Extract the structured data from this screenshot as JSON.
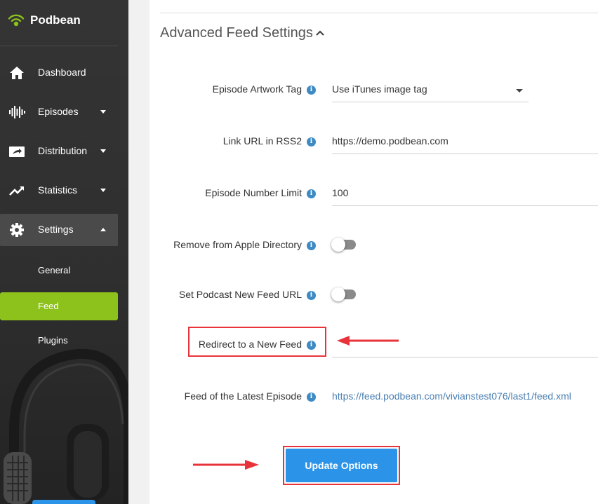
{
  "app": {
    "name": "Podbean",
    "brand_color": "#8cc21b",
    "accent_color": "#2b93e8"
  },
  "sidebar": {
    "items": [
      {
        "label": "Dashboard",
        "icon": "home-icon"
      },
      {
        "label": "Episodes",
        "icon": "waveform-icon",
        "expandable": true
      },
      {
        "label": "Distribution",
        "icon": "share-screen-icon",
        "expandable": true
      },
      {
        "label": "Statistics",
        "icon": "trend-icon",
        "expandable": true
      },
      {
        "label": "Settings",
        "icon": "gear-icon",
        "expandable": true,
        "expanded": true
      }
    ],
    "sub_items": [
      {
        "label": "General"
      },
      {
        "label": "Feed",
        "selected": true
      },
      {
        "label": "Plugins"
      }
    ]
  },
  "main": {
    "section_title": "Advanced Feed Settings",
    "fields": {
      "artwork_tag": {
        "label": "Episode Artwork Tag",
        "value": "Use iTunes image tag"
      },
      "link_url": {
        "label": "Link URL in RSS2",
        "value": "https://demo.podbean.com"
      },
      "episode_limit": {
        "label": "Episode Number Limit",
        "value": "100"
      },
      "remove_apple": {
        "label": "Remove from Apple Directory",
        "on": false
      },
      "new_feed_url": {
        "label": "Set Podcast New Feed URL",
        "on": false
      },
      "redirect": {
        "label": "Redirect to a New Feed",
        "value": ""
      },
      "latest_feed": {
        "label": "Feed of the Latest Episode",
        "value": "https://feed.podbean.com/vivianstest076/last1/feed.xml"
      }
    },
    "info_glyph": "i",
    "submit_label": "Update Options"
  }
}
